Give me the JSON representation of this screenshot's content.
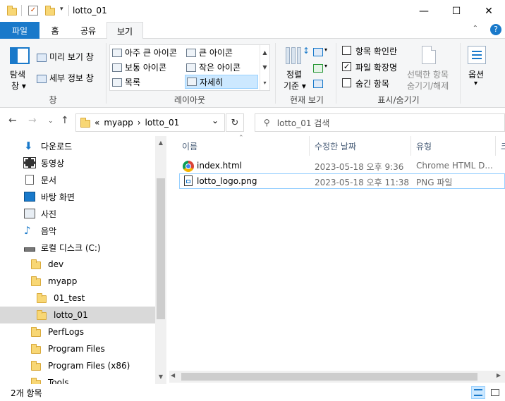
{
  "window": {
    "title": "lotto_01",
    "minimize": "—",
    "maximize": "☐",
    "close": "✕"
  },
  "tabs": [
    {
      "label": "파일"
    },
    {
      "label": "홈"
    },
    {
      "label": "공유"
    },
    {
      "label": "보기"
    }
  ],
  "ribbon": {
    "nav_pane": "탐색\n창 ▾",
    "nav_pane_l1": "탐색",
    "nav_pane_l2": "창 ▾",
    "preview": "미리 보기 창",
    "details_pane": "세부 정보 창",
    "group_panes": "창",
    "layouts": [
      "아주 큰 아이콘",
      "큰 아이콘",
      "보통 아이콘",
      "작은 아이콘",
      "목록",
      "자세히"
    ],
    "group_layout": "레이아웃",
    "sort_l1": "정렬",
    "sort_l2": "기준 ▾",
    "group_view": "현재 보기",
    "chk_item": "항목 확인란",
    "chk_ext": "파일 확장명",
    "chk_hidden": "숨긴 항목",
    "hide_selected_l1": "선택한 항목",
    "hide_selected_l2": "숨기기/해제",
    "group_showhide": "표시/숨기기",
    "options": "옵션",
    "options_arrow": "▾"
  },
  "address": {
    "prefix": "«",
    "seg1": "myapp",
    "sep": "›",
    "seg2": "lotto_01",
    "dropdown": "⌄",
    "refresh": "↻",
    "search_placeholder": "lotto_01 검색"
  },
  "nav_pane": {
    "items": [
      {
        "label": "다운로드"
      },
      {
        "label": "동영상"
      },
      {
        "label": "문서"
      },
      {
        "label": "바탕 화면"
      },
      {
        "label": "사진"
      },
      {
        "label": "음악"
      },
      {
        "label": "로컬 디스크 (C:)"
      },
      {
        "label": "dev"
      },
      {
        "label": "myapp"
      },
      {
        "label": "01_test"
      },
      {
        "label": "lotto_01"
      },
      {
        "label": "PerfLogs"
      },
      {
        "label": "Program Files"
      },
      {
        "label": "Program Files (x86)"
      },
      {
        "label": "Tools"
      }
    ]
  },
  "file_list": {
    "columns": [
      "이름",
      "수정한 날짜",
      "유형",
      "크"
    ],
    "rows": [
      {
        "name": "index.html",
        "modified": "2023-05-18 오후 9:36",
        "type": "Chrome HTML D..."
      },
      {
        "name": "lotto_logo.png",
        "modified": "2023-05-18 오후 11:38",
        "type": "PNG 파일"
      }
    ]
  },
  "status": {
    "count": "2개 항목"
  },
  "colors": {
    "file_tab": "#1979ca",
    "selection": "#cce8ff"
  }
}
